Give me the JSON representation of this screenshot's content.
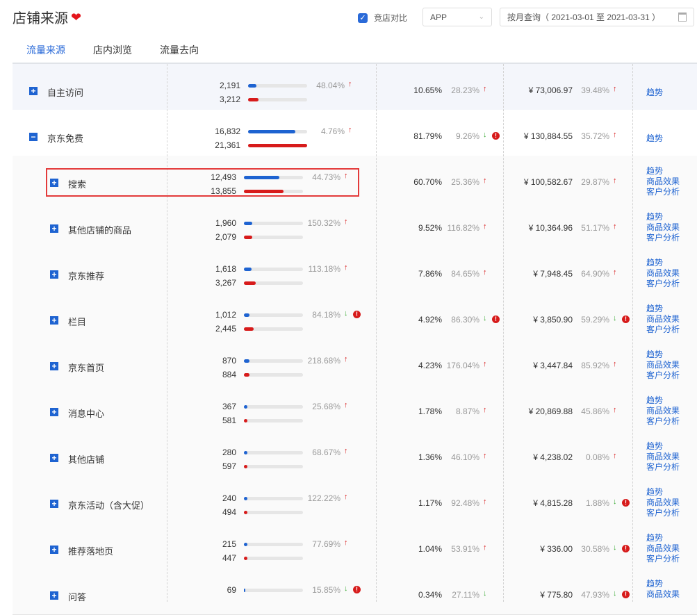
{
  "header": {
    "title": "店铺来源",
    "compare_label": "竞店对比",
    "platform": "APP",
    "date_range": "按月查询（ 2021-03-01 至 2021-03-31 ）"
  },
  "tabs": [
    {
      "label": "流量来源",
      "active": true
    },
    {
      "label": "店内浏览",
      "active": false
    },
    {
      "label": "流量去向",
      "active": false
    }
  ],
  "rows": [
    {
      "name": "自主访问",
      "level": 0,
      "expand": "+",
      "v1": "2,191",
      "v2": "3,212",
      "b1": 0.1449,
      "b2": 0.1713,
      "pct": "48.04%",
      "pct_dir": "up",
      "pct_warn": false,
      "r1": "10.65%",
      "r1p": "28.23%",
      "r1_dir": "up",
      "r1_warn": false,
      "m": "¥ 73,006.97",
      "mp": "39.48%",
      "m_dir": "up",
      "m_warn": false,
      "links": [
        "趋势"
      ]
    },
    {
      "name": "京东免费",
      "level": 0,
      "expand": "−",
      "v1": "16,832",
      "v2": "21,361",
      "b1": 0.8022,
      "b2": 1.0,
      "pct": "4.76%",
      "pct_dir": "up",
      "pct_warn": false,
      "r1": "81.79%",
      "r1p": "9.26%",
      "r1_dir": "down",
      "r1_warn": true,
      "m": "¥ 130,884.55",
      "mp": "35.72%",
      "m_dir": "up",
      "m_warn": false,
      "links": [
        "趋势"
      ]
    },
    {
      "name": "搜索",
      "level": 1,
      "expand": "+",
      "v1": "12,493",
      "v2": "13,855",
      "b1": 0.6011,
      "b2": 0.6679,
      "pct": "44.73%",
      "pct_dir": "up",
      "pct_warn": false,
      "r1": "60.70%",
      "r1p": "25.36%",
      "r1_dir": "up",
      "r1_warn": false,
      "m": "¥ 100,582.67",
      "mp": "29.87%",
      "m_dir": "up",
      "m_warn": false,
      "links": [
        "趋势",
        "商品效果",
        "客户分析"
      ]
    },
    {
      "name": "其他店铺的商品",
      "level": 1,
      "expand": "+",
      "v1": "1,960",
      "v2": "2,079",
      "b1": 0.1424,
      "b2": 0.1424,
      "pct": "150.32%",
      "pct_dir": "up",
      "pct_warn": false,
      "r1": "9.52%",
      "r1p": "116.82%",
      "r1_dir": "up",
      "r1_warn": false,
      "m": "¥ 10,364.96",
      "mp": "51.17%",
      "m_dir": "up",
      "m_warn": false,
      "links": [
        "趋势",
        "商品效果",
        "客户分析"
      ]
    },
    {
      "name": "京东推荐",
      "level": 1,
      "expand": "+",
      "v1": "1,618",
      "v2": "3,267",
      "b1": 0.1286,
      "b2": 0.2045,
      "pct": "113.18%",
      "pct_dir": "up",
      "pct_warn": false,
      "r1": "7.86%",
      "r1p": "84.65%",
      "r1_dir": "up",
      "r1_warn": false,
      "m": "¥ 7,948.45",
      "mp": "64.90%",
      "m_dir": "up",
      "m_warn": false,
      "links": [
        "趋势",
        "商品效果",
        "客户分析"
      ]
    },
    {
      "name": "栏目",
      "level": 1,
      "expand": "+",
      "v1": "1,012",
      "v2": "2,445",
      "b1": 0.0994,
      "b2": 0.1609,
      "pct": "84.18%",
      "pct_dir": "down",
      "pct_warn": true,
      "r1": "4.92%",
      "r1p": "86.30%",
      "r1_dir": "down",
      "r1_warn": true,
      "m": "¥ 3,850.90",
      "mp": "59.29%",
      "m_dir": "down",
      "m_warn": true,
      "links": [
        "趋势",
        "商品效果",
        "客户分析"
      ]
    },
    {
      "name": "京东首页",
      "level": 1,
      "expand": "+",
      "v1": "870",
      "v2": "884",
      "b1": 0.0914,
      "b2": 0.0914,
      "pct": "218.68%",
      "pct_dir": "up",
      "pct_warn": false,
      "r1": "4.23%",
      "r1p": "176.04%",
      "r1_dir": "up",
      "r1_warn": false,
      "m": "¥ 3,447.84",
      "mp": "85.92%",
      "m_dir": "up",
      "m_warn": false,
      "links": [
        "趋势",
        "商品效果",
        "客户分析"
      ]
    },
    {
      "name": "消息中心",
      "level": 1,
      "expand": "+",
      "v1": "367",
      "v2": "581",
      "b1": 0.0551,
      "b2": 0.0551,
      "pct": "25.68%",
      "pct_dir": "up",
      "pct_warn": false,
      "r1": "1.78%",
      "r1p": "8.87%",
      "r1_dir": "up",
      "r1_warn": false,
      "m": "¥ 20,869.88",
      "mp": "45.86%",
      "m_dir": "up",
      "m_warn": false,
      "links": [
        "趋势",
        "商品效果",
        "客户分析"
      ]
    },
    {
      "name": "其他店铺",
      "level": 1,
      "expand": "+",
      "v1": "280",
      "v2": "597",
      "b1": 0.0551,
      "b2": 0.0551,
      "pct": "68.67%",
      "pct_dir": "up",
      "pct_warn": false,
      "r1": "1.36%",
      "r1p": "46.10%",
      "r1_dir": "up",
      "r1_warn": false,
      "m": "¥ 4,238.02",
      "mp": "0.08%",
      "m_dir": "up",
      "m_warn": false,
      "links": [
        "趋势",
        "商品效果",
        "客户分析"
      ]
    },
    {
      "name": "京东活动（含大促）",
      "level": 1,
      "expand": "+",
      "v1": "240",
      "v2": "494",
      "b1": 0.0551,
      "b2": 0.0551,
      "pct": "122.22%",
      "pct_dir": "up",
      "pct_warn": false,
      "r1": "1.17%",
      "r1p": "92.48%",
      "r1_dir": "up",
      "r1_warn": false,
      "m": "¥ 4,815.28",
      "mp": "1.88%",
      "m_dir": "down",
      "m_warn": true,
      "links": [
        "趋势",
        "商品效果",
        "客户分析"
      ]
    },
    {
      "name": "推荐落地页",
      "level": 1,
      "expand": "+",
      "v1": "215",
      "v2": "447",
      "b1": 0.0551,
      "b2": 0.0551,
      "pct": "77.69%",
      "pct_dir": "up",
      "pct_warn": false,
      "r1": "1.04%",
      "r1p": "53.91%",
      "r1_dir": "up",
      "r1_warn": false,
      "m": "¥ 336.00",
      "mp": "30.58%",
      "m_dir": "down",
      "m_warn": true,
      "links": [
        "趋势",
        "商品效果",
        "客户分析"
      ]
    },
    {
      "name": "问答",
      "level": 1,
      "expand": "+",
      "v1": "69",
      "v2": "",
      "b1": 0.01,
      "b2": 0.0,
      "pct": "15.85%",
      "pct_dir": "down",
      "pct_warn": true,
      "r1": "0.34%",
      "r1p": "27.11%",
      "r1_dir": "down",
      "r1_warn": false,
      "m": "¥ 775.80",
      "mp": "47.93%",
      "m_dir": "down",
      "m_warn": true,
      "links": [
        "趋势",
        "商品效果"
      ]
    }
  ]
}
